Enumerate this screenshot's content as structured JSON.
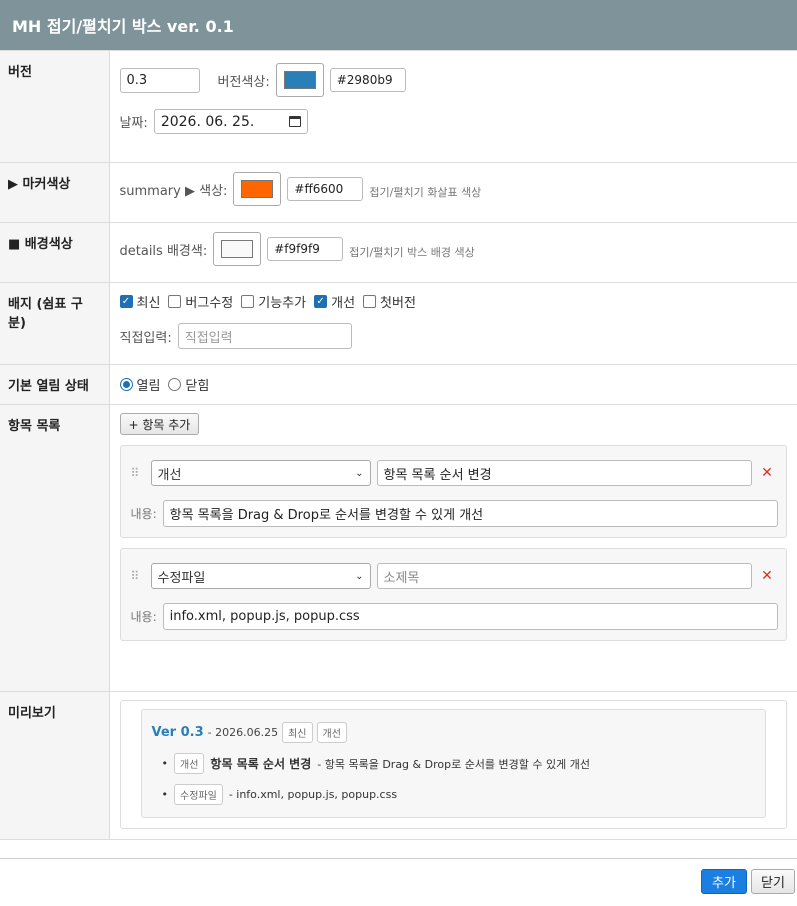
{
  "title": "MH 접기/펼치기 박스 ver. 0.1",
  "version": {
    "label": "버전",
    "value": "0.3",
    "color_label": "버전색상:",
    "color": "#2980b9",
    "date_label": "날짜:",
    "date_value": "2026. 06. 25."
  },
  "marker": {
    "label": "▶ 마커색상",
    "prefix": "summary ▶ 색상:",
    "color": "#ff6600",
    "hint": "접기/펼치기 화살표 색상"
  },
  "background": {
    "label": "■ 배경색상",
    "prefix": "details 배경색:",
    "color": "#f9f9f9",
    "hint": "접기/펼치기 박스 배경 색상"
  },
  "badges": {
    "label": "배지 (쉼표 구분)",
    "options": [
      {
        "text": "최신",
        "checked": true
      },
      {
        "text": "버그수정",
        "checked": false
      },
      {
        "text": "기능추가",
        "checked": false
      },
      {
        "text": "개선",
        "checked": true
      },
      {
        "text": "첫버전",
        "checked": false
      }
    ],
    "direct_label": "직접입력:",
    "direct_placeholder": "직접입력"
  },
  "open_state": {
    "label": "기본 열림 상태",
    "options": [
      {
        "text": "열림",
        "selected": true
      },
      {
        "text": "닫힘",
        "selected": false
      }
    ]
  },
  "items": {
    "label": "항목 목록",
    "add_button": "+ 항목 추가",
    "content_label": "내용:",
    "list": [
      {
        "type": "개선",
        "title": "항목 목록 순서 변경",
        "title_placeholder": "",
        "content": "항목 목록을 Drag & Drop로 순서를 변경할 수 있게 개선"
      },
      {
        "type": "수정파일",
        "title": "",
        "title_placeholder": "소제목",
        "content": "info.xml, popup.js, popup.css"
      }
    ]
  },
  "preview": {
    "label": "미리보기",
    "ver": "Ver 0.3",
    "date": "- 2026.06.25",
    "badges": [
      "최신",
      "개선"
    ],
    "lines": [
      {
        "tag": "개선",
        "title": "항목 목록 순서 변경",
        "text": "- 항목 목록을 Drag & Drop로 순서를 변경할 수 있게 개선"
      },
      {
        "tag": "수정파일",
        "title": "",
        "text": "- info.xml, popup.js, popup.css"
      }
    ]
  },
  "footer": {
    "ok": "추가",
    "close": "닫기"
  }
}
